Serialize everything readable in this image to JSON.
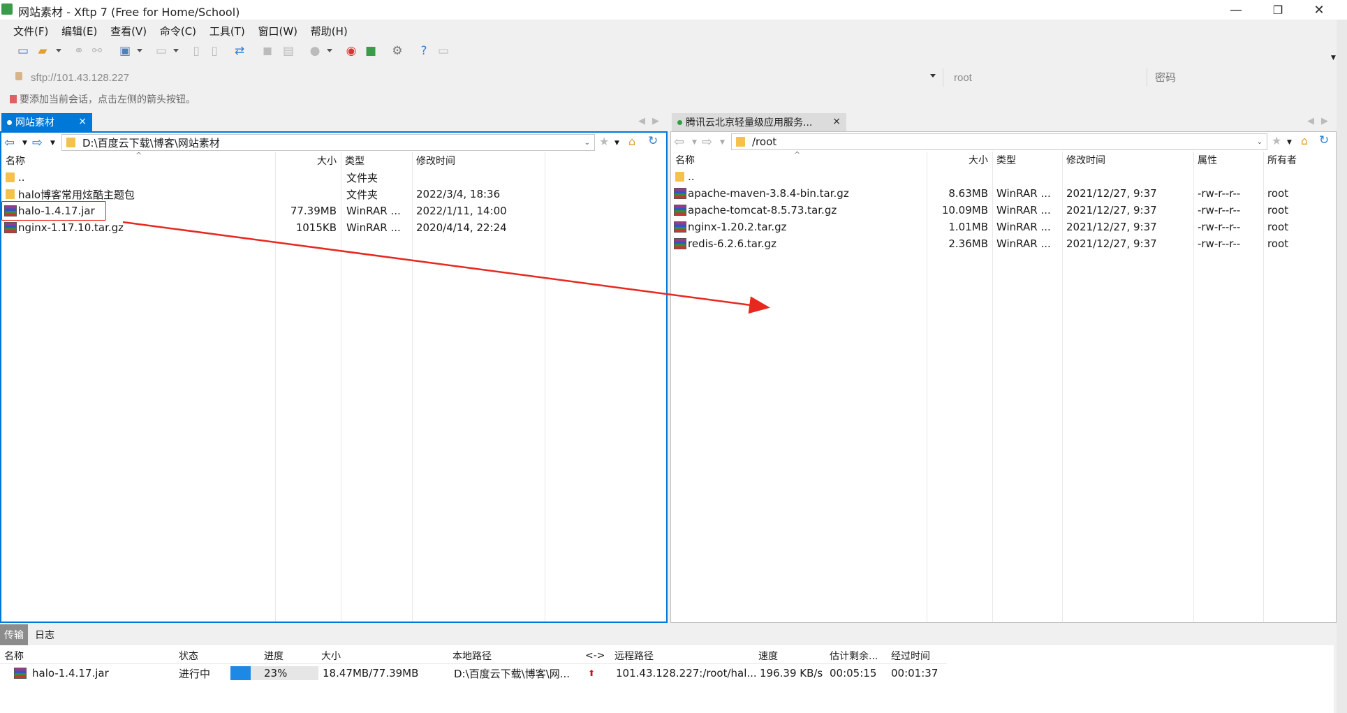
{
  "window": {
    "title": "网站素材 - Xftp 7 (Free for Home/School)",
    "controls": {
      "minimize": "—",
      "maximize": "❐",
      "close": "✕"
    }
  },
  "menu": [
    "文件(F)",
    "编辑(E)",
    "查看(V)",
    "命令(C)",
    "工具(T)",
    "窗口(W)",
    "帮助(H)"
  ],
  "address": {
    "url": "sftp://101.43.128.227",
    "user": "root",
    "password_placeholder": "密码"
  },
  "hint": "要添加当前会话，点击左侧的箭头按钮。",
  "left_pane": {
    "tab": "网站素材",
    "path": "D:\\百度云下载\\博客\\网站素材",
    "columns": [
      "名称",
      "大小",
      "类型",
      "修改时间"
    ],
    "rows": [
      {
        "name": "..",
        "size": "",
        "type": "文件夹",
        "modified": "",
        "icon": "folder"
      },
      {
        "name": "halo博客常用炫酷主题包",
        "size": "",
        "type": "文件夹",
        "modified": "2022/3/4, 18:36",
        "icon": "folder"
      },
      {
        "name": "halo-1.4.17.jar",
        "size": "77.39MB",
        "type": "WinRAR ...",
        "modified": "2022/1/11, 14:00",
        "icon": "rar"
      },
      {
        "name": "nginx-1.17.10.tar.gz",
        "size": "1015KB",
        "type": "WinRAR ...",
        "modified": "2020/4/14, 22:24",
        "icon": "rar"
      }
    ]
  },
  "right_pane": {
    "tab": "腾讯云北京轻量级应用服务...",
    "path": "/root",
    "columns": [
      "名称",
      "大小",
      "类型",
      "修改时间",
      "属性",
      "所有者"
    ],
    "rows": [
      {
        "name": "..",
        "size": "",
        "type": "",
        "modified": "",
        "attr": "",
        "owner": "",
        "icon": "folder"
      },
      {
        "name": "apache-maven-3.8.4-bin.tar.gz",
        "size": "8.63MB",
        "type": "WinRAR ...",
        "modified": "2021/12/27, 9:37",
        "attr": "-rw-r--r--",
        "owner": "root",
        "icon": "rar"
      },
      {
        "name": "apache-tomcat-8.5.73.tar.gz",
        "size": "10.09MB",
        "type": "WinRAR ...",
        "modified": "2021/12/27, 9:37",
        "attr": "-rw-r--r--",
        "owner": "root",
        "icon": "rar"
      },
      {
        "name": "nginx-1.20.2.tar.gz",
        "size": "1.01MB",
        "type": "WinRAR ...",
        "modified": "2021/12/27, 9:37",
        "attr": "-rw-r--r--",
        "owner": "root",
        "icon": "rar"
      },
      {
        "name": "redis-6.2.6.tar.gz",
        "size": "2.36MB",
        "type": "WinRAR ...",
        "modified": "2021/12/27, 9:37",
        "attr": "-rw-r--r--",
        "owner": "root",
        "icon": "rar"
      }
    ]
  },
  "transfer": {
    "tabs": [
      "传输",
      "日志"
    ],
    "columns": [
      "名称",
      "状态",
      "进度",
      "大小",
      "本地路径",
      "<->",
      "远程路径",
      "速度",
      "估计剩余...",
      "经过时间"
    ],
    "row": {
      "name": "halo-1.4.17.jar",
      "status": "进行中",
      "progress_text": "23%",
      "progress": 0.23,
      "size": "18.47MB/77.39MB",
      "local": "D:\\百度云下载\\博客\\网...",
      "direction": "⬆",
      "remote": "101.43.128.227:/root/hal...",
      "speed": "196.39 KB/s",
      "remaining": "00:05:15",
      "elapsed": "00:01:37"
    }
  },
  "colors": {
    "accent": "#0078d7",
    "annotation": "#e8281e",
    "remote_dot": "#2ea043"
  }
}
